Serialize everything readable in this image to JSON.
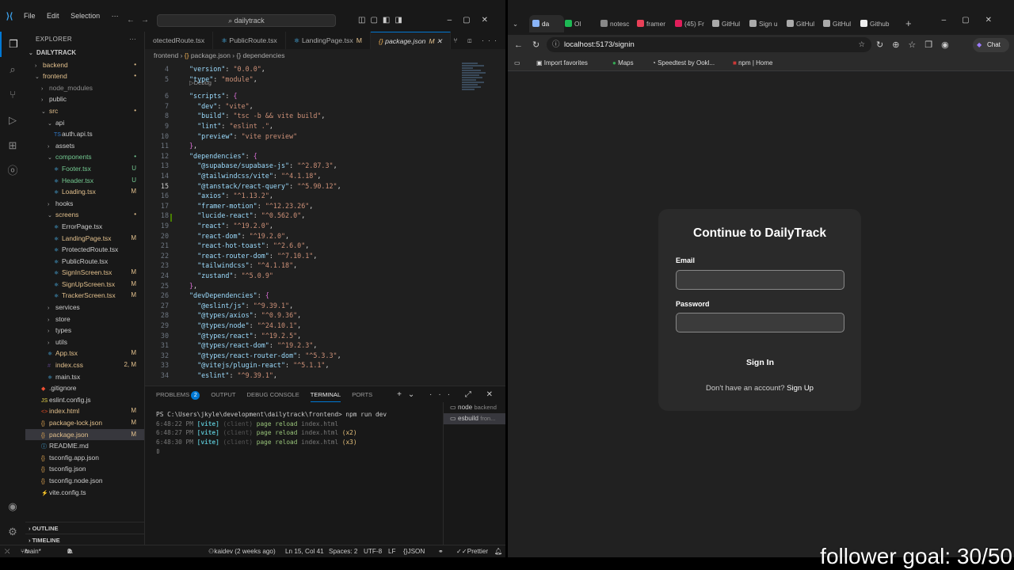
{
  "vscode": {
    "menu": [
      "File",
      "Edit",
      "Selection",
      "···"
    ],
    "search_text": "dailytrack",
    "explorer_title": "EXPLORER",
    "root": "DAILYTRACK",
    "tree": [
      {
        "label": "backend",
        "depth": 0,
        "type": "folder",
        "open": false,
        "color": "m",
        "badge": "•"
      },
      {
        "label": "frontend",
        "depth": 0,
        "type": "folder",
        "open": true,
        "color": "m",
        "badge": "•"
      },
      {
        "label": "node_modules",
        "depth": 1,
        "type": "folder",
        "open": false,
        "color": "ign",
        "badge": ""
      },
      {
        "label": "public",
        "depth": 1,
        "type": "folder",
        "open": false,
        "color": "",
        "badge": ""
      },
      {
        "label": "src",
        "depth": 1,
        "type": "folder",
        "open": true,
        "color": "m",
        "badge": "•"
      },
      {
        "label": "api",
        "depth": 2,
        "type": "folder",
        "open": true,
        "color": "",
        "badge": ""
      },
      {
        "label": "auth.api.ts",
        "depth": 3,
        "type": "ts",
        "color": "",
        "badge": ""
      },
      {
        "label": "assets",
        "depth": 2,
        "type": "folder",
        "open": false,
        "color": "",
        "badge": ""
      },
      {
        "label": "components",
        "depth": 2,
        "type": "folder",
        "open": true,
        "color": "u",
        "badge": "•"
      },
      {
        "label": "Footer.tsx",
        "depth": 3,
        "type": "tsx",
        "color": "u",
        "badge": "U"
      },
      {
        "label": "Header.tsx",
        "depth": 3,
        "type": "tsx",
        "color": "u",
        "badge": "U"
      },
      {
        "label": "Loading.tsx",
        "depth": 3,
        "type": "tsx",
        "color": "m",
        "badge": "M"
      },
      {
        "label": "hooks",
        "depth": 2,
        "type": "folder",
        "open": false,
        "color": "",
        "badge": ""
      },
      {
        "label": "screens",
        "depth": 2,
        "type": "folder",
        "open": true,
        "color": "m",
        "badge": "•"
      },
      {
        "label": "ErrorPage.tsx",
        "depth": 3,
        "type": "tsx",
        "color": "",
        "badge": ""
      },
      {
        "label": "LandingPage.tsx",
        "depth": 3,
        "type": "tsx",
        "color": "m",
        "badge": "M"
      },
      {
        "label": "ProtectedRoute.tsx",
        "depth": 3,
        "type": "tsx",
        "color": "",
        "badge": ""
      },
      {
        "label": "PublicRoute.tsx",
        "depth": 3,
        "type": "tsx",
        "color": "",
        "badge": ""
      },
      {
        "label": "SignInScreen.tsx",
        "depth": 3,
        "type": "tsx",
        "color": "m",
        "badge": "M"
      },
      {
        "label": "SignUpScreen.tsx",
        "depth": 3,
        "type": "tsx",
        "color": "m",
        "badge": "M"
      },
      {
        "label": "TrackerScreen.tsx",
        "depth": 3,
        "type": "tsx",
        "color": "m",
        "badge": "M"
      },
      {
        "label": "services",
        "depth": 2,
        "type": "folder",
        "open": false,
        "color": "",
        "badge": ""
      },
      {
        "label": "store",
        "depth": 2,
        "type": "folder",
        "open": false,
        "color": "",
        "badge": ""
      },
      {
        "label": "types",
        "depth": 2,
        "type": "folder",
        "open": false,
        "color": "",
        "badge": ""
      },
      {
        "label": "utils",
        "depth": 2,
        "type": "folder",
        "open": false,
        "color": "",
        "badge": ""
      },
      {
        "label": "App.tsx",
        "depth": 2,
        "type": "tsx",
        "color": "m",
        "badge": "M"
      },
      {
        "label": "index.css",
        "depth": 2,
        "type": "css",
        "color": "m",
        "badge": "2, M"
      },
      {
        "label": "main.tsx",
        "depth": 2,
        "type": "tsx",
        "color": "",
        "badge": ""
      },
      {
        "label": ".gitignore",
        "depth": 1,
        "type": "git",
        "color": "",
        "badge": ""
      },
      {
        "label": "eslint.config.js",
        "depth": 1,
        "type": "js",
        "color": "",
        "badge": ""
      },
      {
        "label": "index.html",
        "depth": 1,
        "type": "html",
        "color": "m",
        "badge": "M"
      },
      {
        "label": "package-lock.json",
        "depth": 1,
        "type": "json",
        "color": "m",
        "badge": "M"
      },
      {
        "label": "package.json",
        "depth": 1,
        "type": "json",
        "color": "m",
        "badge": "M",
        "selected": true
      },
      {
        "label": "README.md",
        "depth": 1,
        "type": "md",
        "color": "",
        "badge": ""
      },
      {
        "label": "tsconfig.app.json",
        "depth": 1,
        "type": "json",
        "color": "",
        "badge": ""
      },
      {
        "label": "tsconfig.json",
        "depth": 1,
        "type": "json",
        "color": "",
        "badge": ""
      },
      {
        "label": "tsconfig.node.json",
        "depth": 1,
        "type": "json",
        "color": "",
        "badge": ""
      },
      {
        "label": "vite.config.ts",
        "depth": 1,
        "type": "vite",
        "color": "",
        "badge": ""
      }
    ],
    "outline_label": "OUTLINE",
    "timeline_label": "TIMELINE",
    "tabs": [
      {
        "label": "otectedRoute.tsx",
        "badge": ""
      },
      {
        "label": "PublicRoute.tsx",
        "badge": ""
      },
      {
        "label": "LandingPage.tsx",
        "badge": "M"
      },
      {
        "label": "package.json",
        "badge": "M",
        "active": true
      }
    ],
    "breadcrumb": {
      "folder": "frontend",
      "file": "package.json",
      "node": "{} dependencies"
    },
    "codelens": "▷Debug",
    "code_lines": [
      {
        "n": "4",
        "t": [
          [
            "k",
            "\"version\""
          ],
          [
            "p",
            ": "
          ],
          [
            "s",
            "\"0.0.0\""
          ],
          [
            "p",
            ","
          ]
        ]
      },
      {
        "n": "5",
        "t": [
          [
            "k",
            "\"type\""
          ],
          [
            "p",
            ": "
          ],
          [
            "s",
            "\"module\""
          ],
          [
            "p",
            ","
          ]
        ]
      },
      {
        "n": "6",
        "t": [
          [
            "k",
            "\"scripts\""
          ],
          [
            "p",
            ": "
          ],
          [
            "b",
            "{"
          ]
        ]
      },
      {
        "n": "7",
        "t": [
          [
            "p",
            "  "
          ],
          [
            "k",
            "\"dev\""
          ],
          [
            "p",
            ": "
          ],
          [
            "s",
            "\"vite\""
          ],
          [
            "p",
            ","
          ]
        ]
      },
      {
        "n": "8",
        "t": [
          [
            "p",
            "  "
          ],
          [
            "k",
            "\"build\""
          ],
          [
            "p",
            ": "
          ],
          [
            "s",
            "\"tsc -b && vite build\""
          ],
          [
            "p",
            ","
          ]
        ]
      },
      {
        "n": "9",
        "t": [
          [
            "p",
            "  "
          ],
          [
            "k",
            "\"lint\""
          ],
          [
            "p",
            ": "
          ],
          [
            "s",
            "\"eslint .\""
          ],
          [
            "p",
            ","
          ]
        ]
      },
      {
        "n": "10",
        "t": [
          [
            "p",
            "  "
          ],
          [
            "k",
            "\"preview\""
          ],
          [
            "p",
            ": "
          ],
          [
            "s",
            "\"vite preview\""
          ]
        ]
      },
      {
        "n": "11",
        "t": [
          [
            "b",
            "}"
          ],
          [
            "p",
            ","
          ]
        ]
      },
      {
        "n": "12",
        "t": [
          [
            "k",
            "\"dependencies\""
          ],
          [
            "p",
            ": "
          ],
          [
            "b",
            "{"
          ]
        ]
      },
      {
        "n": "13",
        "t": [
          [
            "p",
            "  "
          ],
          [
            "k",
            "\"@supabase/supabase-js\""
          ],
          [
            "p",
            ": "
          ],
          [
            "s",
            "\"^2.87.3\""
          ],
          [
            "p",
            ","
          ]
        ]
      },
      {
        "n": "14",
        "t": [
          [
            "p",
            "  "
          ],
          [
            "k",
            "\"@tailwindcss/vite\""
          ],
          [
            "p",
            ": "
          ],
          [
            "s",
            "\"^4.1.18\""
          ],
          [
            "p",
            ","
          ]
        ]
      },
      {
        "n": "15",
        "t": [
          [
            "p",
            "  "
          ],
          [
            "k",
            "\"@tanstack/react-query\""
          ],
          [
            "p",
            ": "
          ],
          [
            "s",
            "\"^5.90.12\""
          ],
          [
            "p",
            ","
          ]
        ]
      },
      {
        "n": "16",
        "t": [
          [
            "p",
            "  "
          ],
          [
            "k",
            "\"axios\""
          ],
          [
            "p",
            ": "
          ],
          [
            "s",
            "\"^1.13.2\""
          ],
          [
            "p",
            ","
          ]
        ]
      },
      {
        "n": "17",
        "t": [
          [
            "p",
            "  "
          ],
          [
            "k",
            "\"framer-motion\""
          ],
          [
            "p",
            ": "
          ],
          [
            "s",
            "\"^12.23.26\""
          ],
          [
            "p",
            ","
          ]
        ]
      },
      {
        "n": "18",
        "t": [
          [
            "p",
            "  "
          ],
          [
            "k",
            "\"lucide-react\""
          ],
          [
            "p",
            ": "
          ],
          [
            "s",
            "\"^0.562.0\""
          ],
          [
            "p",
            ","
          ]
        ]
      },
      {
        "n": "19",
        "t": [
          [
            "p",
            "  "
          ],
          [
            "k",
            "\"react\""
          ],
          [
            "p",
            ": "
          ],
          [
            "s",
            "\"^19.2.0\""
          ],
          [
            "p",
            ","
          ]
        ]
      },
      {
        "n": "20",
        "t": [
          [
            "p",
            "  "
          ],
          [
            "k",
            "\"react-dom\""
          ],
          [
            "p",
            ": "
          ],
          [
            "s",
            "\"^19.2.0\""
          ],
          [
            "p",
            ","
          ]
        ]
      },
      {
        "n": "21",
        "t": [
          [
            "p",
            "  "
          ],
          [
            "k",
            "\"react-hot-toast\""
          ],
          [
            "p",
            ": "
          ],
          [
            "s",
            "\"^2.6.0\""
          ],
          [
            "p",
            ","
          ]
        ]
      },
      {
        "n": "22",
        "t": [
          [
            "p",
            "  "
          ],
          [
            "k",
            "\"react-router-dom\""
          ],
          [
            "p",
            ": "
          ],
          [
            "s",
            "\"^7.10.1\""
          ],
          [
            "p",
            ","
          ]
        ]
      },
      {
        "n": "23",
        "t": [
          [
            "p",
            "  "
          ],
          [
            "k",
            "\"tailwindcss\""
          ],
          [
            "p",
            ": "
          ],
          [
            "s",
            "\"^4.1.18\""
          ],
          [
            "p",
            ","
          ]
        ]
      },
      {
        "n": "24",
        "t": [
          [
            "p",
            "  "
          ],
          [
            "k",
            "\"zustand\""
          ],
          [
            "p",
            ": "
          ],
          [
            "s",
            "\"^5.0.9\""
          ]
        ]
      },
      {
        "n": "25",
        "t": [
          [
            "b",
            "}"
          ],
          [
            "p",
            ","
          ]
        ]
      },
      {
        "n": "26",
        "t": [
          [
            "k",
            "\"devDependencies\""
          ],
          [
            "p",
            ": "
          ],
          [
            "b",
            "{"
          ]
        ]
      },
      {
        "n": "27",
        "t": [
          [
            "p",
            "  "
          ],
          [
            "k",
            "\"@eslint/js\""
          ],
          [
            "p",
            ": "
          ],
          [
            "s",
            "\"^9.39.1\""
          ],
          [
            "p",
            ","
          ]
        ]
      },
      {
        "n": "28",
        "t": [
          [
            "p",
            "  "
          ],
          [
            "k",
            "\"@types/axios\""
          ],
          [
            "p",
            ": "
          ],
          [
            "s",
            "\"^0.9.36\""
          ],
          [
            "p",
            ","
          ]
        ]
      },
      {
        "n": "29",
        "t": [
          [
            "p",
            "  "
          ],
          [
            "k",
            "\"@types/node\""
          ],
          [
            "p",
            ": "
          ],
          [
            "s",
            "\"^24.10.1\""
          ],
          [
            "p",
            ","
          ]
        ]
      },
      {
        "n": "30",
        "t": [
          [
            "p",
            "  "
          ],
          [
            "k",
            "\"@types/react\""
          ],
          [
            "p",
            ": "
          ],
          [
            "s",
            "\"^19.2.5\""
          ],
          [
            "p",
            ","
          ]
        ]
      },
      {
        "n": "31",
        "t": [
          [
            "p",
            "  "
          ],
          [
            "k",
            "\"@types/react-dom\""
          ],
          [
            "p",
            ": "
          ],
          [
            "s",
            "\"^19.2.3\""
          ],
          [
            "p",
            ","
          ]
        ]
      },
      {
        "n": "32",
        "t": [
          [
            "p",
            "  "
          ],
          [
            "k",
            "\"@types/react-router-dom\""
          ],
          [
            "p",
            ": "
          ],
          [
            "s",
            "\"^5.3.3\""
          ],
          [
            "p",
            ","
          ]
        ]
      },
      {
        "n": "33",
        "t": [
          [
            "p",
            "  "
          ],
          [
            "k",
            "\"@vitejs/plugin-react\""
          ],
          [
            "p",
            ": "
          ],
          [
            "s",
            "\"^5.1.1\""
          ],
          [
            "p",
            ","
          ]
        ]
      },
      {
        "n": "34",
        "t": [
          [
            "p",
            "  "
          ],
          [
            "k",
            "\"eslint\""
          ],
          [
            "p",
            ": "
          ],
          [
            "s",
            "\"^9.39.1\""
          ],
          [
            "p",
            ","
          ]
        ]
      }
    ],
    "panel_tabs": [
      "PROBLEMS",
      "OUTPUT",
      "DEBUG CONSOLE",
      "TERMINAL",
      "PORTS"
    ],
    "problems_count": "2",
    "terminal": {
      "prompt": "PS C:\\Users\\jkyle\\development\\dailytrack\\frontend> npm run dev",
      "lines": [
        {
          "time": "6:48:22 PM",
          "tag": "[vite]",
          "client": "(client)",
          "msg": "page reload",
          "file": "index.html",
          "count": ""
        },
        {
          "time": "6:48:27 PM",
          "tag": "[vite]",
          "client": "(client)",
          "msg": "page reload",
          "file": "index.html",
          "count": "(x2)"
        },
        {
          "time": "6:48:30 PM",
          "tag": "[vite]",
          "client": "(client)",
          "msg": "page reload",
          "file": "index.html",
          "count": "(x3)"
        }
      ]
    },
    "terminal_list": [
      {
        "name": "node",
        "sub": "backend"
      },
      {
        "name": "esbuild",
        "sub": "fron..."
      }
    ],
    "status": {
      "branch": "main*",
      "errors": "0",
      "warnings": "2",
      "blame": "kaidev (2 weeks ago)",
      "position": "Ln 15, Col 41",
      "spaces": "Spaces: 2",
      "encoding": "UTF-8",
      "eol": "LF",
      "language": "JSON",
      "prettier": "Prettier"
    }
  },
  "browser": {
    "tabs": [
      {
        "label": "da",
        "color": "#8ab4f8",
        "active": true
      },
      {
        "label": "Ol",
        "color": "#1db954"
      },
      {
        "label": "notesc",
        "color": "#888"
      },
      {
        "label": "framer",
        "color": "#e94057"
      },
      {
        "label": "(45) Fr",
        "color": "#e01e5a"
      },
      {
        "label": "GitHul",
        "color": "#aaa"
      },
      {
        "label": "Sign u",
        "color": "#aaa"
      },
      {
        "label": "GitHul",
        "color": "#aaa"
      },
      {
        "label": "GitHul",
        "color": "#aaa"
      },
      {
        "label": "Github",
        "color": "#eee"
      }
    ],
    "url": "localhost:5173/signin",
    "chat_label": "Chat",
    "bookmarks": [
      {
        "label": "Import favorites"
      },
      {
        "label": "Maps"
      },
      {
        "label": "Speedtest by Ookl..."
      },
      {
        "label": "npm | Home"
      }
    ]
  },
  "signin": {
    "title": "Continue to DailyTrack",
    "email_label": "Email",
    "email_value": "",
    "password_label": "Password",
    "password_value": "",
    "button": "Sign In",
    "footer_text": "Don't have an account?",
    "footer_link": "Sign Up"
  },
  "overlay_text": "follower goal: 30/50"
}
